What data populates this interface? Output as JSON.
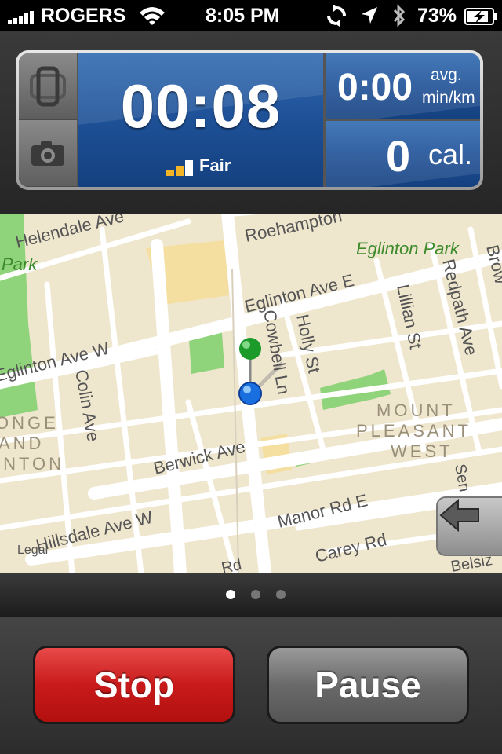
{
  "status_bar": {
    "carrier": "ROGERS",
    "time": "8:05 PM",
    "battery_percent": "73%",
    "signal_icon": "signal-bars-icon",
    "wifi_icon": "wifi-icon",
    "sync_icon": "sync-icon",
    "location_icon": "location-arrow-icon",
    "bluetooth_icon": "bluetooth-icon",
    "battery_icon": "battery-charging-icon"
  },
  "dashboard": {
    "timer": "00:08",
    "gps_signal_label": "Fair",
    "pace_value": "0:00",
    "pace_unit_line1": "avg.",
    "pace_unit_line2": "min/km",
    "calories_value": "0",
    "calories_unit": "cal.",
    "view_toggle_icon": "phone-rotate-icon",
    "camera_icon": "camera-icon"
  },
  "map": {
    "legal_label": "Legal",
    "street_labels": [
      "Helendale Ave",
      "Roehampton",
      "Eglinton Park",
      "Park",
      "Eglinton Ave E",
      "Eglinton Ave W",
      "Colin Ave",
      "Cowbell Ln",
      "Holly St",
      "Lillian St",
      "Redpath Ave",
      "Brow",
      "Berwick Ave",
      "Manor Rd E",
      "Hillsdale Ave W",
      "Carey Rd",
      "Belsiz",
      "Sen",
      "Rd"
    ],
    "district_labels": [
      "MOUNT",
      "PLEASANT",
      "WEST",
      "ONGE",
      "AND",
      "INTON"
    ],
    "back_icon": "left-arrow-icon"
  },
  "page_indicator": {
    "total": 3,
    "active": 1
  },
  "controls": {
    "stop_label": "Stop",
    "pause_label": "Pause"
  },
  "colors": {
    "panel_blue": "#1f5299",
    "stop_red": "#c81a1a",
    "pause_gray": "#6a6a6a",
    "map_bg": "#efe6ce",
    "park_green": "#8fd37a",
    "block_tan": "#f5dfa0",
    "gps_yellow": "#f3b526"
  }
}
